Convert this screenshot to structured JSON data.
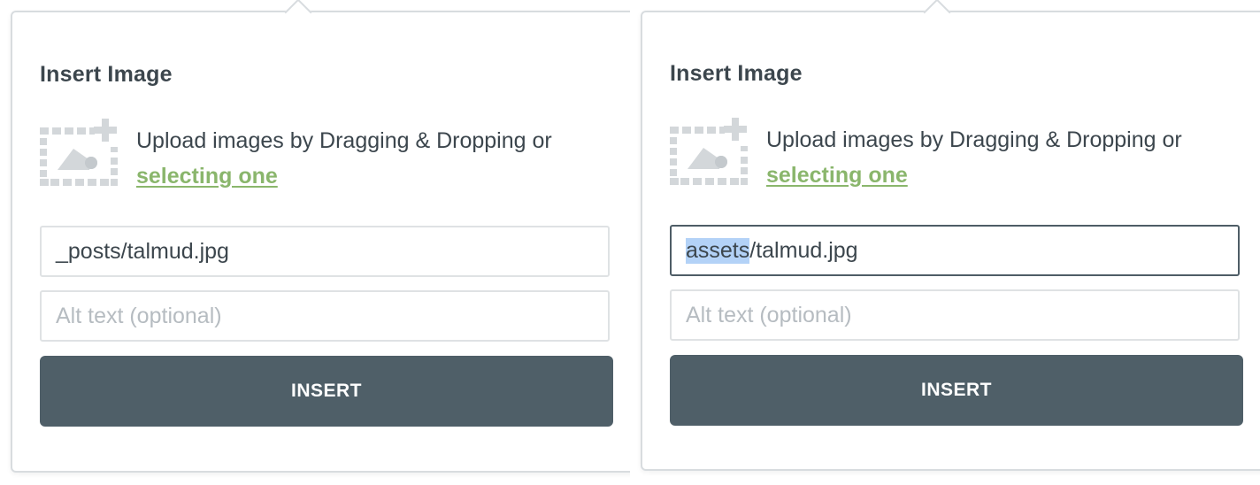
{
  "panels": [
    {
      "title": "Insert Image",
      "upload": {
        "text": "Upload images by Dragging & Dropping or",
        "link": "selecting one"
      },
      "path_field": {
        "value": "_posts/talmud.jpg"
      },
      "alt_field": {
        "placeholder": "Alt text (optional)"
      },
      "insert_label": "INSERT"
    },
    {
      "title": "Insert Image",
      "upload": {
        "text": "Upload images by Dragging & Dropping or",
        "link": "selecting one"
      },
      "path_field": {
        "selected": "assets",
        "rest": "/talmud.jpg"
      },
      "alt_field": {
        "placeholder": "Alt text (optional)"
      },
      "insert_label": "INSERT"
    }
  ],
  "colors": {
    "text": "#3c464d",
    "link": "#8ab66c",
    "button": "#4f5f68",
    "placeholder": "#b6bcc1",
    "selection": "#b3d2f7",
    "icon": "#d3d7da"
  },
  "icons": {
    "upload": "image-add-icon"
  }
}
